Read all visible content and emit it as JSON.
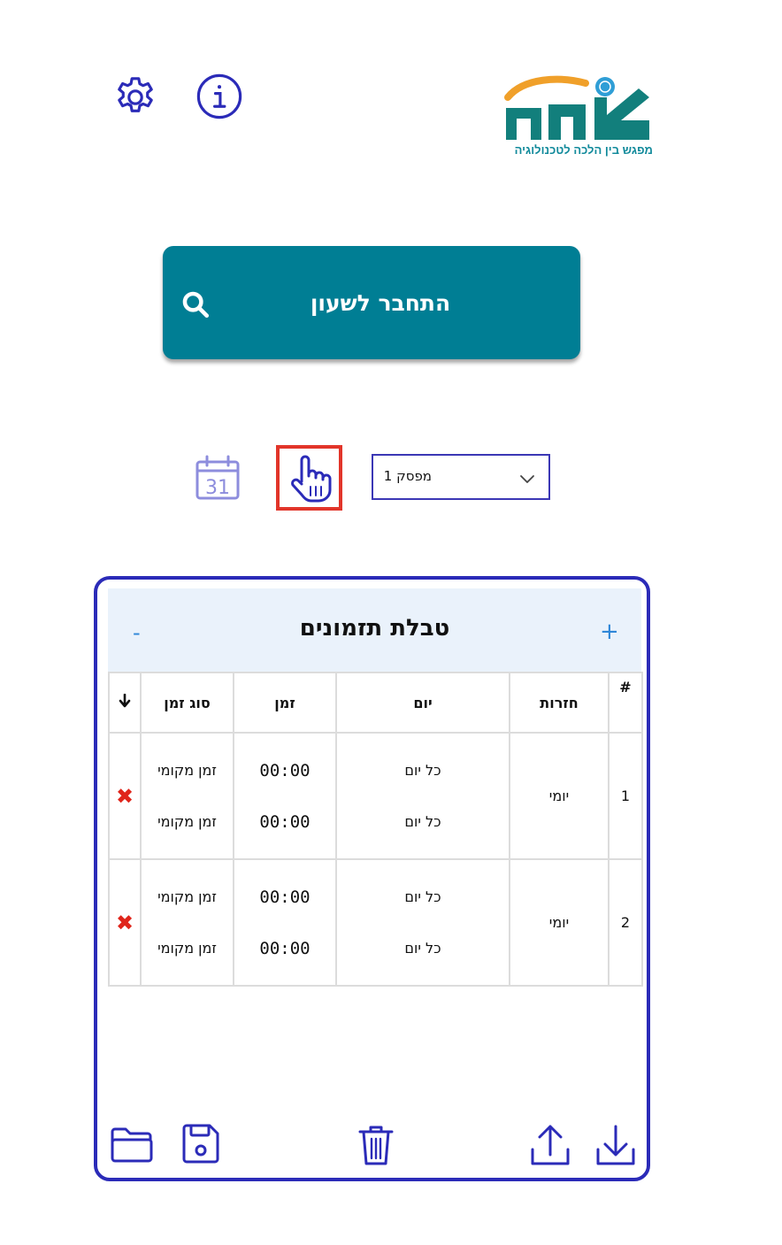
{
  "header": {
    "settings_icon": "gear-icon",
    "info_icon": "info-icon",
    "logo_text": "מפגש בין הלכה לטכנולוגיה",
    "logo_mark": "צמת"
  },
  "connect": {
    "label": "התחבר לשעון",
    "icon": "search-icon"
  },
  "controls": {
    "calendar_day": "31",
    "manual_icon": "hand-pointer-icon",
    "switch_select_value": "מפסק 1"
  },
  "schedule": {
    "title": "טבלת תזמונים",
    "minus_label": "-",
    "plus_label": "+",
    "columns": {
      "number": "#",
      "repeat": "חזרות",
      "day": "יום",
      "time": "זמן",
      "time_type": "סוג זמן"
    },
    "rows": [
      {
        "number": "1",
        "repeat": "יומי",
        "days": [
          "כל יום",
          "כל יום"
        ],
        "times": [
          "00:00",
          "00:00"
        ],
        "time_types": [
          "זמן מקומי",
          "זמן מקומי"
        ]
      },
      {
        "number": "2",
        "repeat": "יומי",
        "days": [
          "כל יום",
          "כל יום"
        ],
        "times": [
          "00:00",
          "00:00"
        ],
        "time_types": [
          "זמן מקומי",
          "זמן מקומי"
        ]
      }
    ]
  },
  "toolbar": {
    "icons": [
      "folder-icon",
      "save-icon",
      "trash-icon",
      "upload-icon",
      "download-icon"
    ]
  },
  "colors": {
    "primary_blue": "#2b2bb8",
    "teal_button": "#007e94",
    "delete_red": "#e0251b",
    "highlight_frame": "#e2352a"
  }
}
